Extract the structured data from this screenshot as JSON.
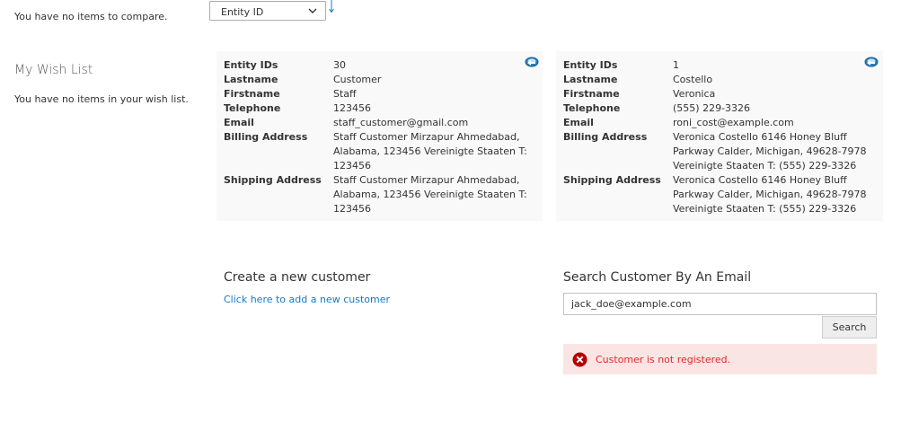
{
  "sidebar": {
    "compare_empty": "You have no items to compare.",
    "wishlist_title": "My Wish List",
    "wishlist_empty": "You have no items in your wish list."
  },
  "sort": {
    "selected": "Entity ID",
    "icons": [
      "chevron-down-icon",
      "sort-arrow-icon"
    ]
  },
  "customers": [
    {
      "rows": [
        {
          "label": "Entity IDs",
          "value": "30"
        },
        {
          "label": "Lastname",
          "value": "Customer"
        },
        {
          "label": "Firstname",
          "value": "Staff"
        },
        {
          "label": "Telephone",
          "value": "123456"
        },
        {
          "label": "Email",
          "value": "staff_customer@gmail.com"
        },
        {
          "label": "Billing Address",
          "value_lines": [
            "Staff Customer Mirzapur Ahmedabad,",
            "Alabama, 123456 Vereinigte Staaten T:",
            "123456"
          ]
        },
        {
          "label": "Shipping Address",
          "value_lines": [
            "Staff Customer Mirzapur Ahmedabad,",
            "Alabama, 123456 Vereinigte Staaten T:",
            "123456"
          ]
        }
      ]
    },
    {
      "rows": [
        {
          "label": "Entity IDs",
          "value": "1"
        },
        {
          "label": "Lastname",
          "value": "Costello"
        },
        {
          "label": "Firstname",
          "value": "Veronica"
        },
        {
          "label": "Telephone",
          "value": "(555) 229-3326"
        },
        {
          "label": "Email",
          "value": "roni_cost@example.com"
        },
        {
          "label": "Billing Address",
          "value_lines": [
            "Veronica Costello 6146 Honey Bluff",
            "Parkway Calder, Michigan, 49628-7978",
            "Vereinigte Staaten T: (555) 229-3326"
          ]
        },
        {
          "label": "Shipping Address",
          "value_lines": [
            "Veronica Costello 6146 Honey Bluff",
            "Parkway Calder, Michigan, 49628-7978",
            "Vereinigte Staaten T: (555) 229-3326"
          ]
        }
      ]
    }
  ],
  "create": {
    "title": "Create a new customer",
    "link": "Click here to add a new customer"
  },
  "search": {
    "title": "Search Customer By An Email",
    "value": "jack_doe@example.com",
    "button": "Search"
  },
  "error": {
    "message": "Customer is not registered.",
    "color": "#e02b27",
    "background": "#fae5e5"
  },
  "colors": {
    "link": "#1979c3",
    "card_bg": "#f9f9f9"
  }
}
